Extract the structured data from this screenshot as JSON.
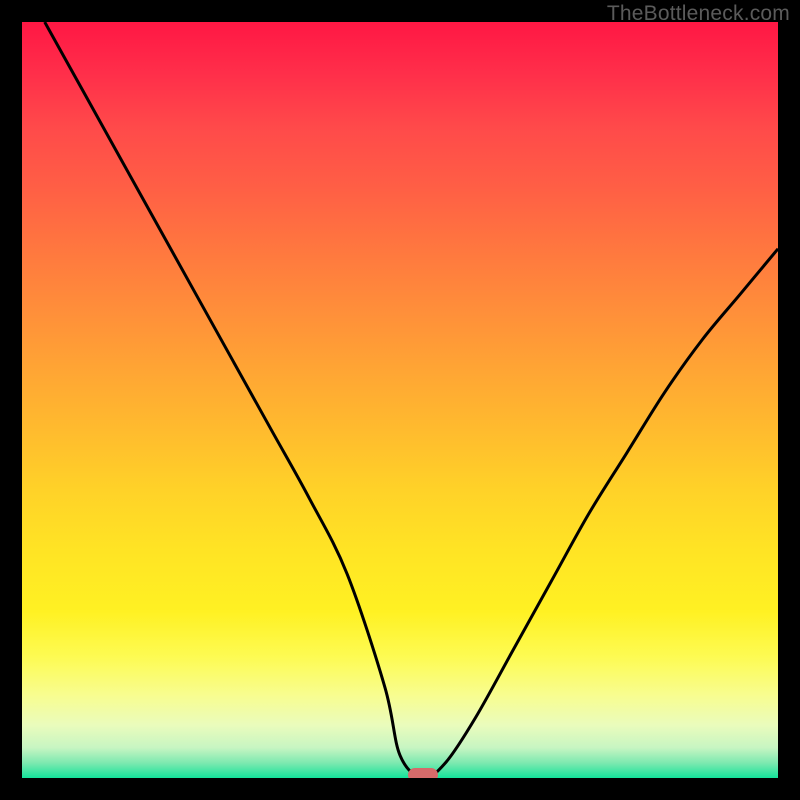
{
  "watermark": "TheBottleneck.com",
  "colors": {
    "background": "#000000",
    "gradient_top": "#ff1744",
    "gradient_mid": "#ffd228",
    "gradient_bottom": "#13e29a",
    "curve_stroke": "#000000",
    "dot_fill": "#d66a6a",
    "watermark_text": "#5b5b5b"
  },
  "chart_data": {
    "type": "line",
    "title": "",
    "xlabel": "",
    "ylabel": "",
    "xlim": [
      0,
      100
    ],
    "ylim": [
      0,
      100
    ],
    "annotations": [
      {
        "name": "minimum-marker",
        "x": 53,
        "y": 0
      }
    ],
    "series": [
      {
        "name": "bottleneck-curve",
        "x": [
          3,
          8,
          13,
          18,
          23,
          28,
          33,
          38,
          43,
          48,
          50,
          53,
          56,
          60,
          65,
          70,
          75,
          80,
          85,
          90,
          95,
          100
        ],
        "values": [
          100,
          91,
          82,
          73,
          64,
          55,
          46,
          37,
          27,
          12,
          3,
          0,
          2,
          8,
          17,
          26,
          35,
          43,
          51,
          58,
          64,
          70
        ]
      }
    ]
  }
}
